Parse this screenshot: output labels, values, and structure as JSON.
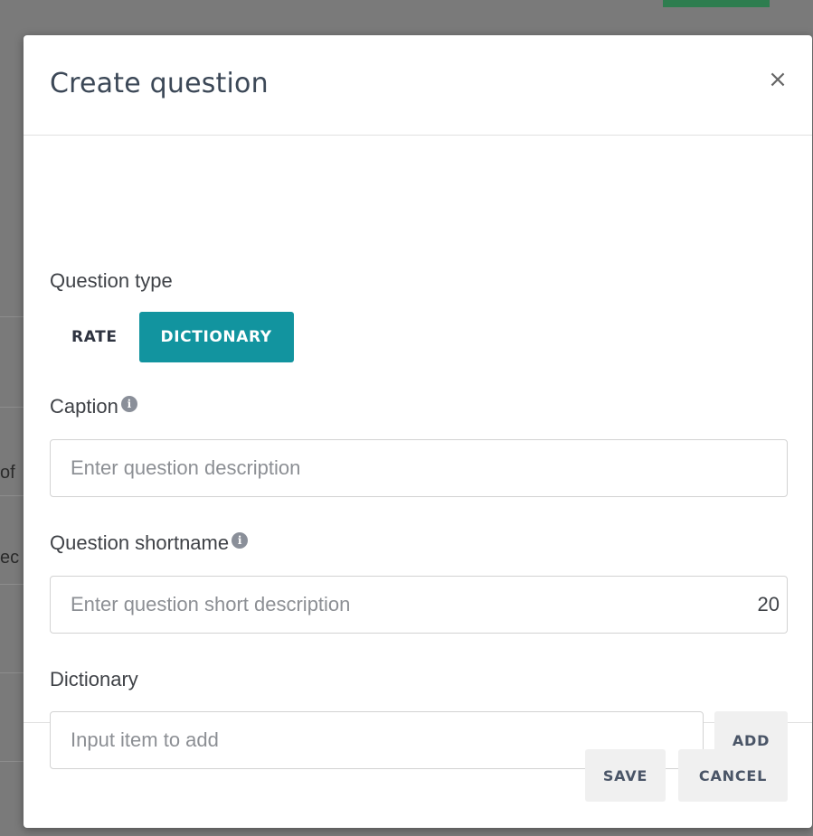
{
  "background": {
    "text_fragment_1": "of",
    "text_fragment_2": "ec"
  },
  "modal": {
    "title": "Create question",
    "close_symbol": "×",
    "question_type": {
      "label": "Question type",
      "options": [
        "RATE",
        "DICTIONARY"
      ],
      "selected": "DICTIONARY"
    },
    "caption": {
      "label": "Caption",
      "placeholder": "Enter question description",
      "value": ""
    },
    "shortname": {
      "label": "Question shortname",
      "placeholder": "Enter question short description",
      "value": "",
      "remaining_chars": "20"
    },
    "dictionary": {
      "label": "Dictionary",
      "placeholder": "Input item to add",
      "value": "",
      "add_label": "ADD"
    },
    "footer": {
      "save_label": "SAVE",
      "cancel_label": "CANCEL"
    },
    "info_icon_glyph": "i"
  },
  "colors": {
    "accent": "#12949f",
    "overlay": "#7a7a7a",
    "title_text": "#3c4857"
  }
}
